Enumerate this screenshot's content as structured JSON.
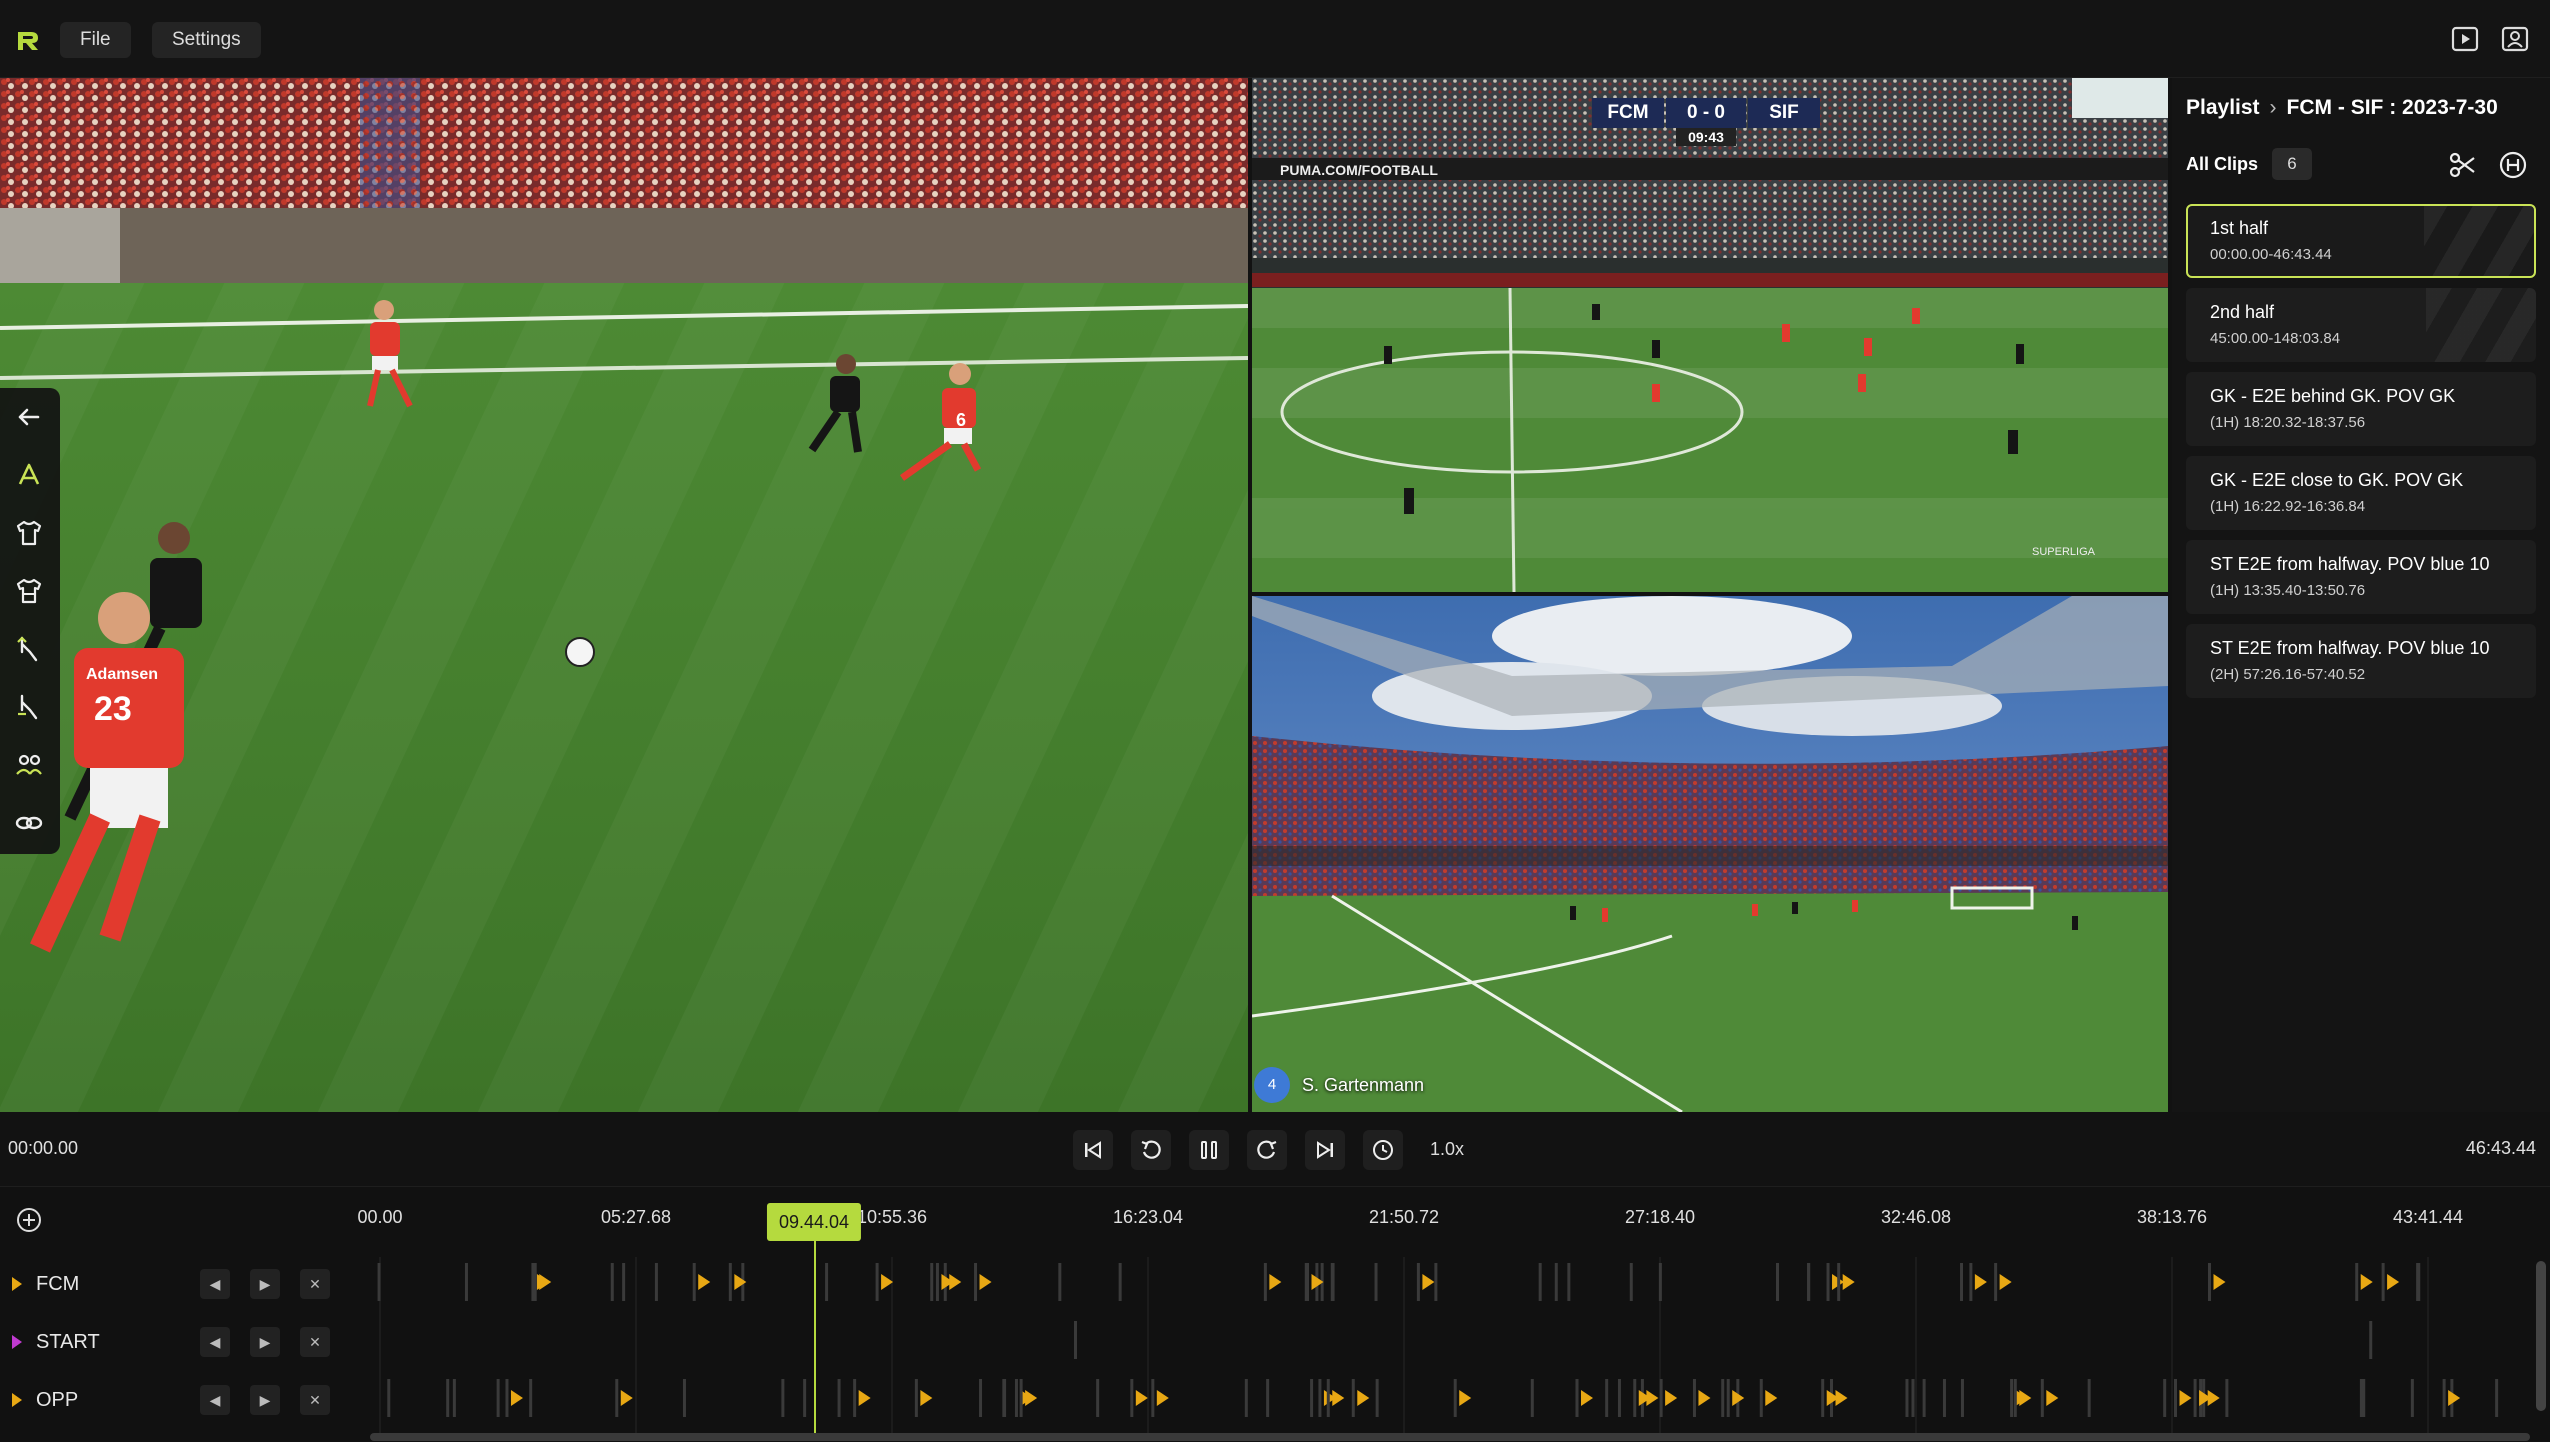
{
  "topbar": {
    "menu": [
      "File",
      "Settings"
    ],
    "icons": [
      "play-video-icon",
      "profile-icon"
    ]
  },
  "overlay": {
    "home_team": "FCM",
    "away_team": "SIF",
    "score": "0 - 0",
    "match_clock": "09:43",
    "ad_text": "PUMA.COM/FOOTBALL",
    "league": "SUPERLIGA",
    "player_number": "4",
    "player_name": "S. Gartenmann",
    "shirt_name": "Adamsen",
    "shirt_number": "23",
    "shirt_number_2": "6"
  },
  "toolrail": [
    "back-arrow-icon",
    "draw-cone-icon",
    "home-shirt-icon",
    "away-shirt-icon",
    "select-hand-icon",
    "pointer-hand-icon",
    "player-link-icon",
    "chain-link-icon"
  ],
  "playlist": {
    "breadcrumb_root": "Playlist",
    "breadcrumb_match": "FCM - SIF : 2023-7-30",
    "all_clips_label": "All Clips",
    "clip_count": "6",
    "clips": [
      {
        "title": "1st half",
        "time": "00:00.00-46:43.44",
        "selected": true
      },
      {
        "title": "2nd half",
        "time": "45:00.00-148:03.84",
        "selected": false
      },
      {
        "title": "GK - E2E behind GK. POV GK",
        "time": "(1H) 18:20.32-18:37.56",
        "selected": false
      },
      {
        "title": "GK - E2E close to GK. POV GK",
        "time": "(1H) 16:22.92-16:36.84",
        "selected": false
      },
      {
        "title": "ST E2E from halfway. POV blue 10",
        "time": "(1H) 13:35.40-13:50.76",
        "selected": false
      },
      {
        "title": "ST E2E from halfway. POV blue 10",
        "time": "(2H) 57:26.16-57:40.52",
        "selected": false
      }
    ]
  },
  "transport": {
    "current_time": "00:00.00",
    "total_time": "46:43.44",
    "speed": "1.0x",
    "buttons": [
      "skip-start-icon",
      "rewind-icon",
      "pause-icon",
      "forward-icon",
      "skip-end-icon",
      "clock-icon"
    ]
  },
  "timeline": {
    "ticks": [
      "00.00",
      "05:27.68",
      "10:55.36",
      "16:23.04",
      "21:50.72",
      "27:18.40",
      "32:46.08",
      "38:13.76",
      "43:41.44"
    ],
    "playhead": "09.44.04",
    "tracks": [
      {
        "name": "FCM",
        "color": "#e8a814"
      },
      {
        "name": "START",
        "color": "#c03ad0"
      },
      {
        "name": "OPP",
        "color": "#e8a814"
      }
    ],
    "accent": "#b5da3e"
  }
}
